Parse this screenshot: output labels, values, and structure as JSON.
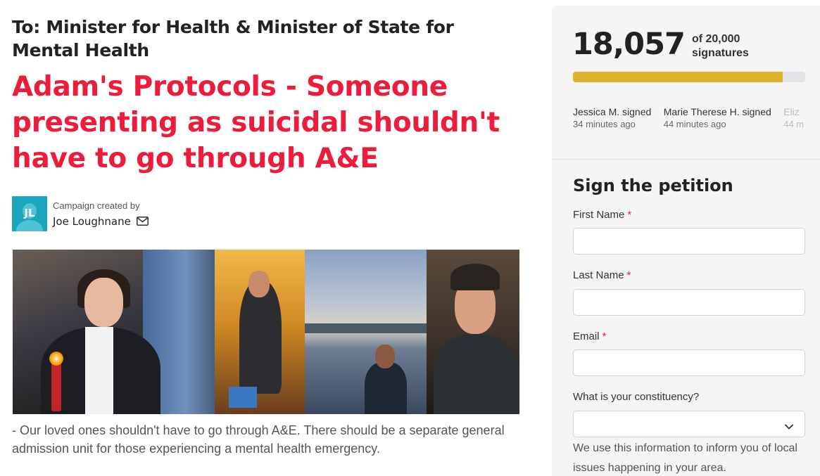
{
  "petition": {
    "to": "To: Minister for Health & Minister of State for Mental Health",
    "title": "Adam's Protocols - Someone presenting as suicidal shouldn't have to go through A&E",
    "creator": {
      "label": "Campaign created by",
      "name": "Joe Loughnane",
      "initials": "JL"
    },
    "summary": "- Our loved ones shouldn't have to go through A&E. There should be a separate general admission unit for those experiencing a mental health emergency."
  },
  "signatures": {
    "count": "18,057",
    "goal_line1": "of 20,000",
    "goal_line2": "signatures",
    "progress_fraction": 0.903,
    "recent": [
      {
        "name": "Jessica M. signed",
        "time": "34 minutes ago"
      },
      {
        "name": "Marie Therese H. signed",
        "time": "44 minutes ago"
      },
      {
        "name": "Eliz",
        "time": "44 m"
      }
    ]
  },
  "form": {
    "title": "Sign the petition",
    "required_mark": "*",
    "first_name_label": "First Name",
    "last_name_label": "Last Name",
    "email_label": "Email",
    "constituency_label": "What is your constituency?",
    "constituency_value": "",
    "help_text": "We use this information to inform you of local issues happening in your area."
  },
  "colors": {
    "title_red": "#ec1c3a",
    "progress_gold": "#dfb22e",
    "avatar_teal": "#19a7bd"
  },
  "icons": {
    "mail": "mail-icon",
    "chevron": "chevron-down-icon"
  }
}
